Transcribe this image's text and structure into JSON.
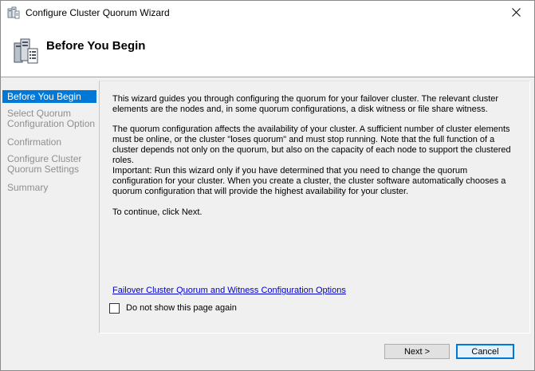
{
  "window": {
    "title": "Configure Cluster Quorum Wizard",
    "close_glyph": "✕"
  },
  "header": {
    "title": "Before You Begin",
    "icon": "cluster-servers-icon"
  },
  "sidebar": {
    "items": [
      {
        "label": "Before You Begin",
        "active": true
      },
      {
        "label": "Select Quorum\nConfiguration Option",
        "active": false
      },
      {
        "label": "Confirmation",
        "active": false
      },
      {
        "label": "Configure Cluster\nQuorum Settings",
        "active": false
      },
      {
        "label": "Summary",
        "active": false
      }
    ]
  },
  "content": {
    "paragraphs": [
      "This wizard guides you through configuring the quorum for your failover cluster. The relevant cluster elements are the nodes and, in some quorum configurations, a disk witness or file share witness.",
      "The quorum configuration affects the availability of your cluster. A sufficient number of cluster elements must be online, or the cluster \"loses quorum\" and must stop running. Note that the full function of a cluster depends not only on the quorum, but also on the capacity of each node to support the clustered roles.",
      "Important: Run this wizard only if you have determined that you need to change the quorum configuration for your cluster. When you create a cluster, the cluster software automatically chooses a quorum configuration that will provide the highest availability for your cluster.",
      "To continue, click Next."
    ],
    "link_text": "Failover Cluster Quorum and Witness Configuration Options",
    "checkbox_label": "Do not show this page again",
    "checkbox_checked": false
  },
  "buttons": {
    "next": "Next >",
    "cancel": "Cancel"
  },
  "colors": {
    "accent": "#0078d7",
    "disabled_text": "#8f8f8f",
    "link": "#0000cc"
  }
}
